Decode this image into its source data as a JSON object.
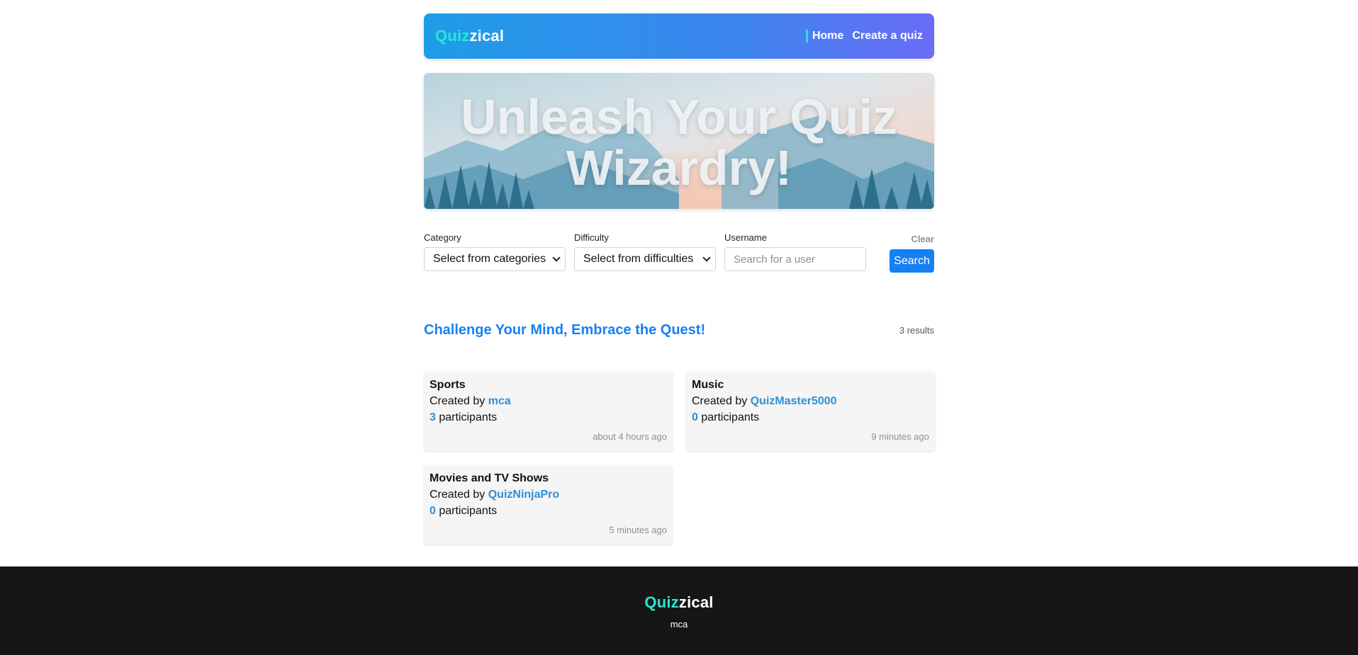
{
  "header": {
    "brand_part1": "Quiz",
    "brand_part2": "zical",
    "nav": [
      {
        "label": "Home",
        "active": true
      },
      {
        "label": "Create a quiz",
        "active": false
      }
    ]
  },
  "hero": {
    "title_line1": "Unleash Your Quiz",
    "title_line2": "Wizardry!"
  },
  "filters": {
    "category_label": "Category",
    "category_value": "Select from categories",
    "difficulty_label": "Difficulty",
    "difficulty_value": "Select from difficulties",
    "username_label": "Username",
    "username_placeholder": "Search for a user",
    "clear_label": "Clear",
    "search_label": "Search"
  },
  "section": {
    "title": "Challenge Your Mind, Embrace the Quest!",
    "results": "3 results"
  },
  "quizzes": [
    {
      "name": "Sports",
      "created_by_label": "Created by",
      "author": "mca",
      "participants": "3",
      "participants_label": "participants",
      "time": "about 4 hours ago"
    },
    {
      "name": "Music",
      "created_by_label": "Created by",
      "author": "QuizMaster5000",
      "participants": "0",
      "participants_label": "participants",
      "time": "9 minutes ago"
    },
    {
      "name": "Movies and TV Shows",
      "created_by_label": "Created by",
      "author": "QuizNinjaPro",
      "participants": "0",
      "participants_label": "participants",
      "time": "5 minutes ago"
    }
  ],
  "footer": {
    "brand_part1": "Quiz",
    "brand_part2": "zical",
    "author": "mca"
  },
  "colors": {
    "accent": "#1580f4",
    "brand_teal": "#27e6d3",
    "link": "#2f8fd8",
    "footer_bg": "#161616"
  }
}
